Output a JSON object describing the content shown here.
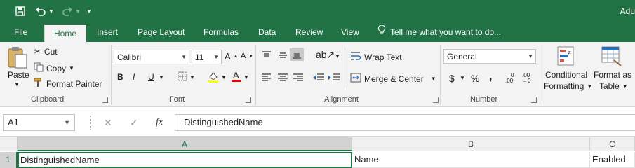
{
  "titlebar": {
    "title": "Adu",
    "bg": "#217346"
  },
  "tabs": [
    "File",
    "Home",
    "Insert",
    "Page Layout",
    "Formulas",
    "Data",
    "Review",
    "View"
  ],
  "tell_me": "Tell me what you want to do...",
  "clipboard": {
    "paste": "Paste",
    "cut": "Cut",
    "copy": "Copy",
    "format_painter": "Format Painter",
    "label": "Clipboard"
  },
  "font": {
    "name": "Calibri",
    "size": "11",
    "label": "Font",
    "bold": "B",
    "italic": "I",
    "underline": "U"
  },
  "alignment": {
    "wrap_text": "Wrap Text",
    "merge_center": "Merge & Center",
    "label": "Alignment"
  },
  "number": {
    "format": "General",
    "label": "Number",
    "currency": "$",
    "percent": "%",
    "comma": ",",
    "inc_decimal": "←0 .00",
    "dec_decimal": ".00 →0"
  },
  "styles": {
    "conditional_1": "Conditional",
    "conditional_2": "Formatting",
    "format_as_1": "Format as",
    "format_as_2": "Table"
  },
  "formula_bar": {
    "name_box": "A1",
    "fx": "fx",
    "value": "DistinguishedName"
  },
  "grid": {
    "columns": [
      "A",
      "B",
      "C"
    ],
    "rows": [
      {
        "num": "1",
        "cells": [
          "DistinguishedName",
          "Name",
          "Enabled"
        ]
      }
    ]
  }
}
